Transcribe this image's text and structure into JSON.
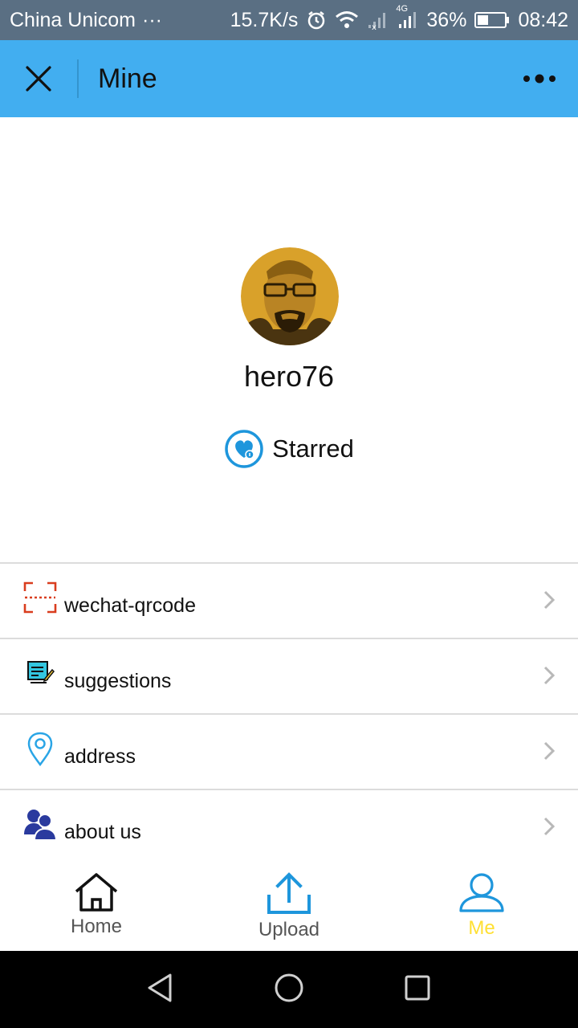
{
  "status_bar": {
    "carrier": "China Unicom",
    "dots": "···",
    "speed": "15.7K/s",
    "network_label": "4G",
    "battery": "36%",
    "time": "08:42"
  },
  "header": {
    "title": "Mine",
    "close_icon": "close-icon",
    "more_icon": "more-icon"
  },
  "profile": {
    "username": "hero76",
    "starred_label": "Starred",
    "starred_icon": "heart-badge-icon"
  },
  "menu": {
    "items": [
      {
        "label": "wechat-qrcode",
        "icon": "qrcode-scan-icon"
      },
      {
        "label": "suggestions",
        "icon": "document-edit-icon"
      },
      {
        "label": "address",
        "icon": "location-pin-icon"
      },
      {
        "label": "about us",
        "icon": "users-icon"
      }
    ]
  },
  "tabs": {
    "items": [
      {
        "label": "Home",
        "icon": "home-icon"
      },
      {
        "label": "Upload",
        "icon": "upload-icon"
      },
      {
        "label": "Me",
        "icon": "user-icon",
        "active": true
      }
    ]
  },
  "colors": {
    "status_bar": "#5a6f83",
    "header": "#42aef0",
    "accent_blue": "#1e96dc",
    "active_tab": "#ffe033",
    "inactive_tab": "#555555"
  }
}
